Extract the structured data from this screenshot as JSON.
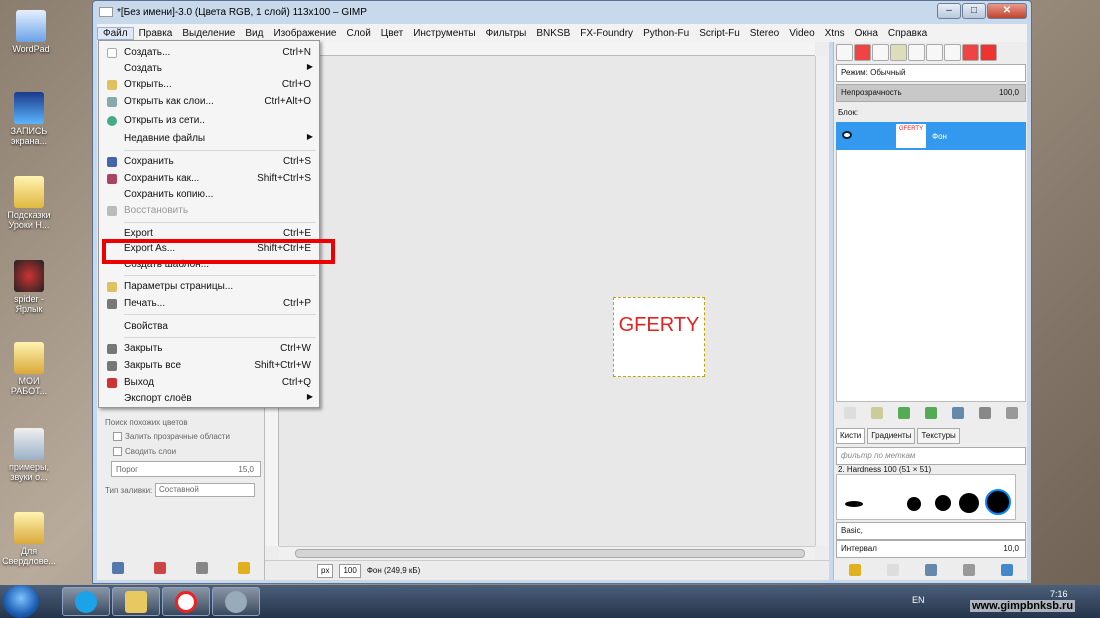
{
  "desktop": {
    "icons": [
      {
        "label": "WordPad"
      },
      {
        "label": "ЗАПИСЬ экрана..."
      },
      {
        "label": "Подсказки Уроки Н..."
      },
      {
        "label": "spider - Ярлык"
      },
      {
        "label": "МОИ РАБОТ..."
      },
      {
        "label": "примеры, звуки о..."
      },
      {
        "label": "Для Свердлове..."
      }
    ]
  },
  "window": {
    "title": "*[Без имени]-3.0 (Цвета RGB, 1 слой) 113x100 – GIMP",
    "buttons": {
      "minimize": "–",
      "maximize": "□",
      "close": "✕"
    }
  },
  "menubar": {
    "items": [
      {
        "label": "Файл"
      },
      {
        "label": "Правка"
      },
      {
        "label": "Выделение"
      },
      {
        "label": "Вид"
      },
      {
        "label": "Изображение"
      },
      {
        "label": "Слой"
      },
      {
        "label": "Цвет"
      },
      {
        "label": "Инструменты"
      },
      {
        "label": "Фильтры"
      },
      {
        "label": "BNKSB"
      },
      {
        "label": "FX-Foundry"
      },
      {
        "label": "Python-Fu"
      },
      {
        "label": "Script-Fu"
      },
      {
        "label": "Stereo"
      },
      {
        "label": "Video"
      },
      {
        "label": "Xtns"
      },
      {
        "label": "Окна"
      },
      {
        "label": "Справка"
      }
    ]
  },
  "file_menu": {
    "items": [
      {
        "label": "Создать...",
        "shortcut": "Ctrl+N",
        "icon": "new-file-icon"
      },
      {
        "label": "Создать",
        "shortcut": "",
        "submenu": true
      },
      {
        "label": "Открыть...",
        "shortcut": "Ctrl+O",
        "icon": "open-folder-icon"
      },
      {
        "label": "Открыть как слои...",
        "shortcut": "Ctrl+Alt+O",
        "icon": "open-layers-icon"
      },
      {
        "label": "Открыть из сети..",
        "shortcut": "",
        "icon": "globe-icon"
      },
      {
        "label": "Недавние файлы",
        "shortcut": "",
        "submenu": true
      },
      {
        "label": "Сохранить",
        "shortcut": "Ctrl+S",
        "icon": "save-icon"
      },
      {
        "label": "Сохранить как...",
        "shortcut": "Shift+Ctrl+S",
        "icon": "save-as-icon"
      },
      {
        "label": "Сохранить копию...",
        "shortcut": ""
      },
      {
        "label": "Восстановить",
        "shortcut": "",
        "icon": "revert-icon",
        "disabled": true
      },
      {
        "label": "Export",
        "shortcut": "Ctrl+E"
      },
      {
        "label": "Export As...",
        "shortcut": "Shift+Ctrl+E"
      },
      {
        "label": "Создать шаблон...",
        "shortcut": ""
      },
      {
        "label": "Параметры страницы...",
        "shortcut": "",
        "icon": "page-setup-icon"
      },
      {
        "label": "Печать...",
        "shortcut": "Ctrl+P",
        "icon": "print-icon"
      },
      {
        "label": "Свойства",
        "shortcut": ""
      },
      {
        "label": "Закрыть",
        "shortcut": "Ctrl+W",
        "icon": "close-x-icon"
      },
      {
        "label": "Закрыть все",
        "shortcut": "Shift+Ctrl+W",
        "icon": "close-all-icon"
      },
      {
        "label": "Выход",
        "shortcut": "Ctrl+Q",
        "icon": "quit-icon"
      },
      {
        "label": "Экспорт слоёв",
        "shortcut": "",
        "submenu": true
      }
    ]
  },
  "tool_options": {
    "search_similar": "Поиск похожих цветов",
    "fill_transparent": "Залить прозрачные области",
    "merge_layers": "Сводить слои",
    "threshold_label": "Порог",
    "threshold_value": "15,0",
    "fill_type_label": "Тип заливки:",
    "fill_type_value": "Составной"
  },
  "canvas": {
    "image_text": "GFERTY",
    "image_text_color": "#e52222"
  },
  "statusbar": {
    "unit": "px",
    "zoom": "100",
    "info": "Фон (249,9 кБ)"
  },
  "layers": {
    "mode_label": "Режим: Обычный",
    "opacity_label": "Непрозрачность",
    "opacity_value": "100,0",
    "lock_label": "Блок:",
    "layer_name": "Фон",
    "layer_thumb_text": "GFERTY"
  },
  "brushes": {
    "tabs": [
      {
        "label": "Кисти"
      },
      {
        "label": "Градиенты"
      },
      {
        "label": "Текстуры"
      }
    ],
    "filter_placeholder": "фильтр по меткам",
    "current": "2. Hardness 100 (51 × 51)",
    "preset": "Basic,",
    "spacing_label": "Интервал",
    "spacing_value": "10,0"
  },
  "taskbar": {
    "language": "EN",
    "time": "7:16",
    "watermark": "www.gimpbnksb.ru"
  }
}
